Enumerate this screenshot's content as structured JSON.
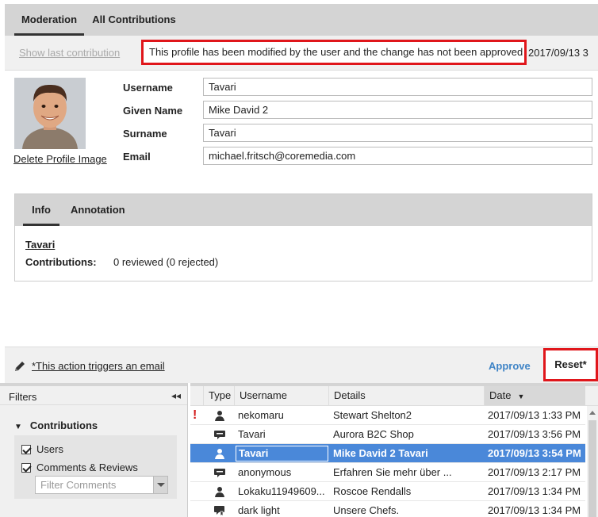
{
  "tabs": {
    "moderation": "Moderation",
    "all_contributions": "All Contributions"
  },
  "notice_row": {
    "show_last": "Show last contribution",
    "notice": "This profile has been modified by the user and the change has not been approved",
    "date": "2017/09/13 3"
  },
  "profile": {
    "delete_image": "Delete Profile Image",
    "fields": {
      "username_label": "Username",
      "username_value": "Tavari",
      "given_label": "Given Name",
      "given_value": "Mike David 2",
      "surname_label": "Surname",
      "surname_value": "Tavari",
      "email_label": "Email",
      "email_value": "michael.fritsch@coremedia.com"
    }
  },
  "info": {
    "tab_info": "Info",
    "tab_annotation": "Annotation",
    "user": "Tavari",
    "contrib_label": "Contributions:",
    "contrib_value": "0 reviewed (0 rejected)"
  },
  "actions": {
    "email_note": "*This action triggers an email",
    "approve": "Approve",
    "reset": "Reset*"
  },
  "filters": {
    "title": "Filters",
    "collapse_glyph": "◂◂",
    "group": "Contributions",
    "users": "Users",
    "comments": "Comments & Reviews",
    "filter_placeholder": "Filter Comments"
  },
  "grid": {
    "columns": {
      "type": "Type",
      "username": "Username",
      "details": "Details",
      "date": "Date"
    },
    "rows": [
      {
        "flag": "!",
        "icon": "user-icon",
        "user": "nekomaru",
        "details": "Stewart Shelton2",
        "date": "2017/09/13 1:33 PM"
      },
      {
        "flag": "",
        "icon": "comment-icon",
        "user": "Tavari",
        "details": "Aurora B2C Shop",
        "date": "2017/09/13 3:56 PM"
      },
      {
        "flag": "",
        "icon": "user-icon",
        "user": "Tavari",
        "details": "Mike David 2 Tavari",
        "date": "2017/09/13 3:54 PM",
        "selected": true
      },
      {
        "flag": "",
        "icon": "comment-icon",
        "user": "anonymous",
        "details": "Erfahren Sie mehr über ...",
        "date": "2017/09/13 2:17 PM"
      },
      {
        "flag": "",
        "icon": "user-icon",
        "user": "Lokaku11949609...",
        "details": "Roscoe Rendalls",
        "date": "2017/09/13 1:34 PM"
      },
      {
        "flag": "",
        "icon": "review-icon",
        "user": "dark light",
        "details": "Unsere Chefs.",
        "date": "2017/09/13 1:34 PM"
      }
    ]
  }
}
